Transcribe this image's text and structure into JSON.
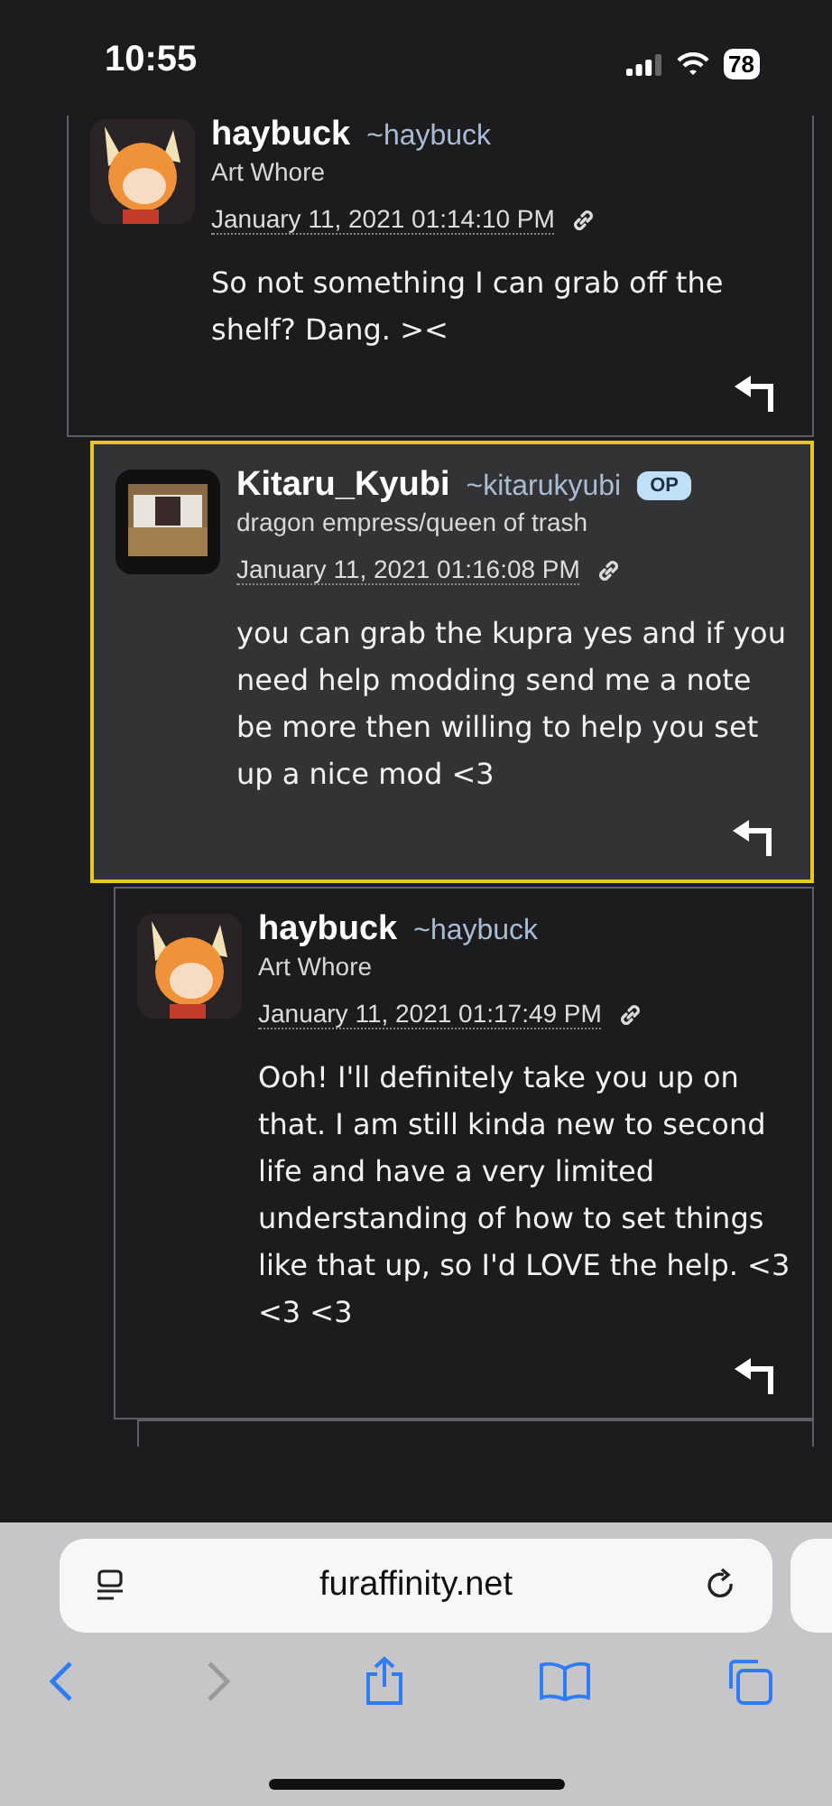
{
  "status_bar": {
    "time": "10:55",
    "battery": "78"
  },
  "comments": [
    {
      "display_name": "haybuck",
      "username": "~haybuck",
      "title": "Art Whore",
      "timestamp": "January 11, 2021 01:14:10 PM",
      "text": "So not something I can grab off the shelf? Dang. ><",
      "highlighted": false,
      "kind": "fox",
      "children": [
        {
          "display_name": "Kitaru_Kyubi",
          "username": "~kitarukyubi",
          "badge": "OP",
          "title": "dragon empress/queen of trash",
          "timestamp": "January 11, 2021 01:16:08 PM",
          "text": "you can grab the kupra yes and if you need help modding send me a note be more then willing to help you set up a nice mod <3",
          "highlighted": true,
          "kind": "booth",
          "children": [
            {
              "display_name": "haybuck",
              "username": "~haybuck",
              "title": "Art Whore",
              "timestamp": "January 11, 2021 01:17:49 PM",
              "text": "Ooh! I'll definitely take you up on that. I am still kinda new to second life and have a very limited understanding of how to set things like that up, so I'd LOVE the help. <3 <3 <3",
              "highlighted": false,
              "kind": "fox"
            }
          ]
        }
      ]
    }
  ],
  "browser": {
    "url": "furaffinity.net",
    "back_disabled": false,
    "forward_disabled": true
  }
}
